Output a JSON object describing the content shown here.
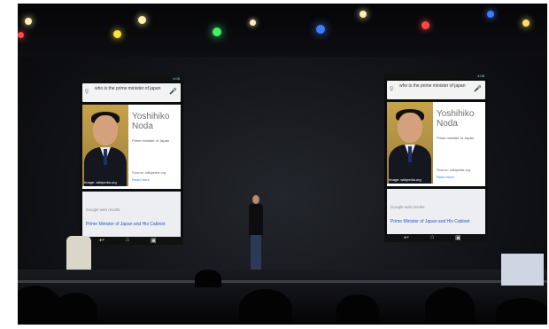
{
  "screens": [
    {
      "side": "left",
      "status": "4:08",
      "query": "who is the prime minister of japan",
      "person_name": "Yoshihiko Noda",
      "person_desc": "Prime minister of Japan",
      "source": "Source: wikipedia.org",
      "read_more": "Read more",
      "image_caption": "Image: wikipedia.org",
      "web_label": "Google web results",
      "result_link": "Prime Minister of Japan and His Cabinet"
    },
    {
      "side": "right",
      "status": "4:08",
      "query": "who is the prime minister of japan",
      "person_name": "Yoshihiko Noda",
      "person_desc": "Prime minister of Japan",
      "source": "Source: wikipedia.org",
      "read_more": "Read more",
      "image_caption": "Image: wikipedia.org",
      "web_label": "Google web results",
      "result_link": "Prime Minister of Japan and His Cabinet"
    }
  ],
  "light_colors": [
    "#ffefb0",
    "#ff4747",
    "#ffe238",
    "#44f06a",
    "#3d7bff",
    "#ffdd66",
    "#3d7bff"
  ],
  "stage_color": "#0b0b10"
}
